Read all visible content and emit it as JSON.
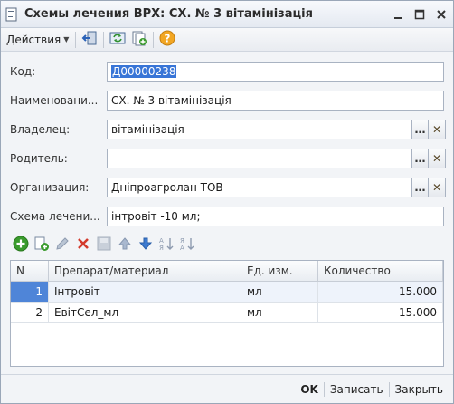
{
  "window": {
    "title": "Схемы лечения ВРХ: СХ. № 3 вітамінізація",
    "icon": "document-icon"
  },
  "toolbar": {
    "actions_label": "Действия",
    "buttons": [
      "exit-icon",
      "refresh-icon",
      "new-copy-icon",
      "help-icon"
    ]
  },
  "form": {
    "code": {
      "label": "Код:",
      "value": "Д00000238"
    },
    "name": {
      "label": "Наименовани...",
      "value": "СХ. № 3 вітамінізація"
    },
    "owner": {
      "label": "Владелец:",
      "value": "вітамінізація"
    },
    "parent": {
      "label": "Родитель:",
      "value": ""
    },
    "organization": {
      "label": "Организация:",
      "value": "Дніпроагролан ТОВ"
    },
    "scheme": {
      "label": "Схема лечени...",
      "value": "інтровіт -10 мл;"
    }
  },
  "table": {
    "columns": [
      "N",
      "Препарат/материал",
      "Ед. изм.",
      "Количество"
    ],
    "rows": [
      {
        "n": "1",
        "material": "Інтровіт",
        "unit": "мл",
        "qty": "15.000"
      },
      {
        "n": "2",
        "material": "ЕвітСел_мл",
        "unit": "мл",
        "qty": "15.000"
      }
    ]
  },
  "footer": {
    "ok": "OK",
    "save": "Записать",
    "close": "Закрыть"
  },
  "colors": {
    "selection": "#3875d7",
    "accent_green": "#3a9b2d",
    "accent_red": "#d33a2c"
  }
}
